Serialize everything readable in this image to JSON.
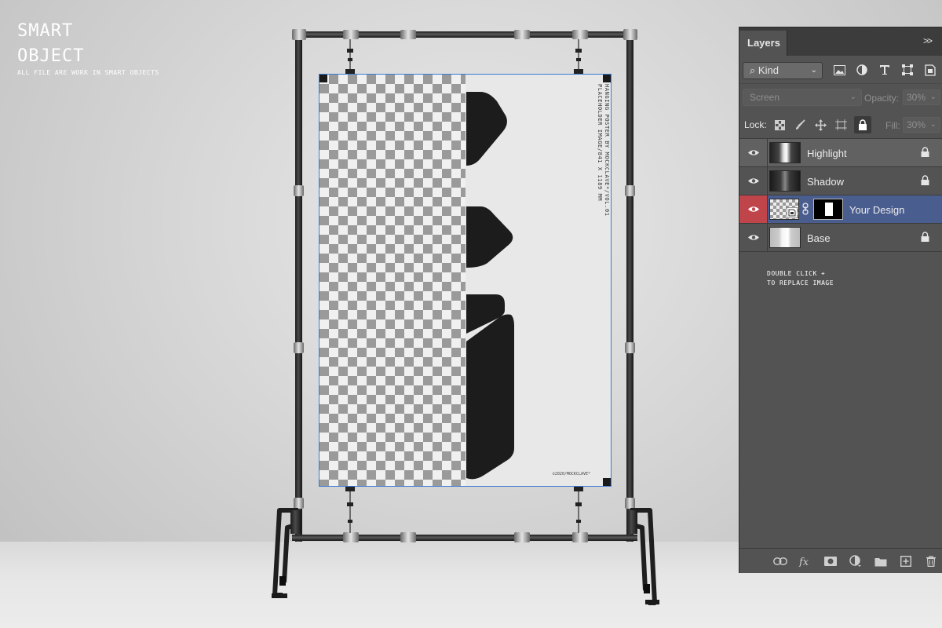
{
  "heading": {
    "line1": "SMART",
    "line2": "OBJECT",
    "subtitle": "ALL FILE ARE WORK IN SMART OBJECTS"
  },
  "poster": {
    "vertical_text": "HANGING POSTER BY MOCKCLAVE*/VOL.01\nPLACEHOLDER IMAGE/841 X 1189 MM",
    "credit": "©2020/MOCKCLAVE*"
  },
  "panel": {
    "tab_label": "Layers",
    "collapse_label": ">>",
    "filter": {
      "kind_label": "Kind",
      "icons": [
        "image-filter-icon",
        "adjustment-filter-icon",
        "type-filter-icon",
        "shape-filter-icon",
        "smart-object-filter-icon"
      ]
    },
    "blend_mode": "Screen",
    "opacity_label": "Opacity:",
    "opacity_value": "30%",
    "lock_label": "Lock:",
    "fill_label": "Fill:",
    "fill_value": "30%",
    "layers": [
      {
        "name": "Highlight",
        "visible": true,
        "locked": true,
        "state": "highlighted"
      },
      {
        "name": "Shadow",
        "visible": true,
        "locked": true,
        "state": "normal"
      },
      {
        "name": "Your Design",
        "visible": true,
        "locked": false,
        "state": "selected"
      },
      {
        "name": "Base",
        "visible": true,
        "locked": true,
        "state": "normal"
      }
    ],
    "hint_line1": "DOUBLE CLICK ⌖",
    "hint_line2": "TO REPLACE IMAGE"
  },
  "colors": {
    "panel_bg": "#535353",
    "selected_layer": "#4a5d8f",
    "visibility_active": "#c0454a",
    "selection_outline": "#3a7bd5"
  }
}
